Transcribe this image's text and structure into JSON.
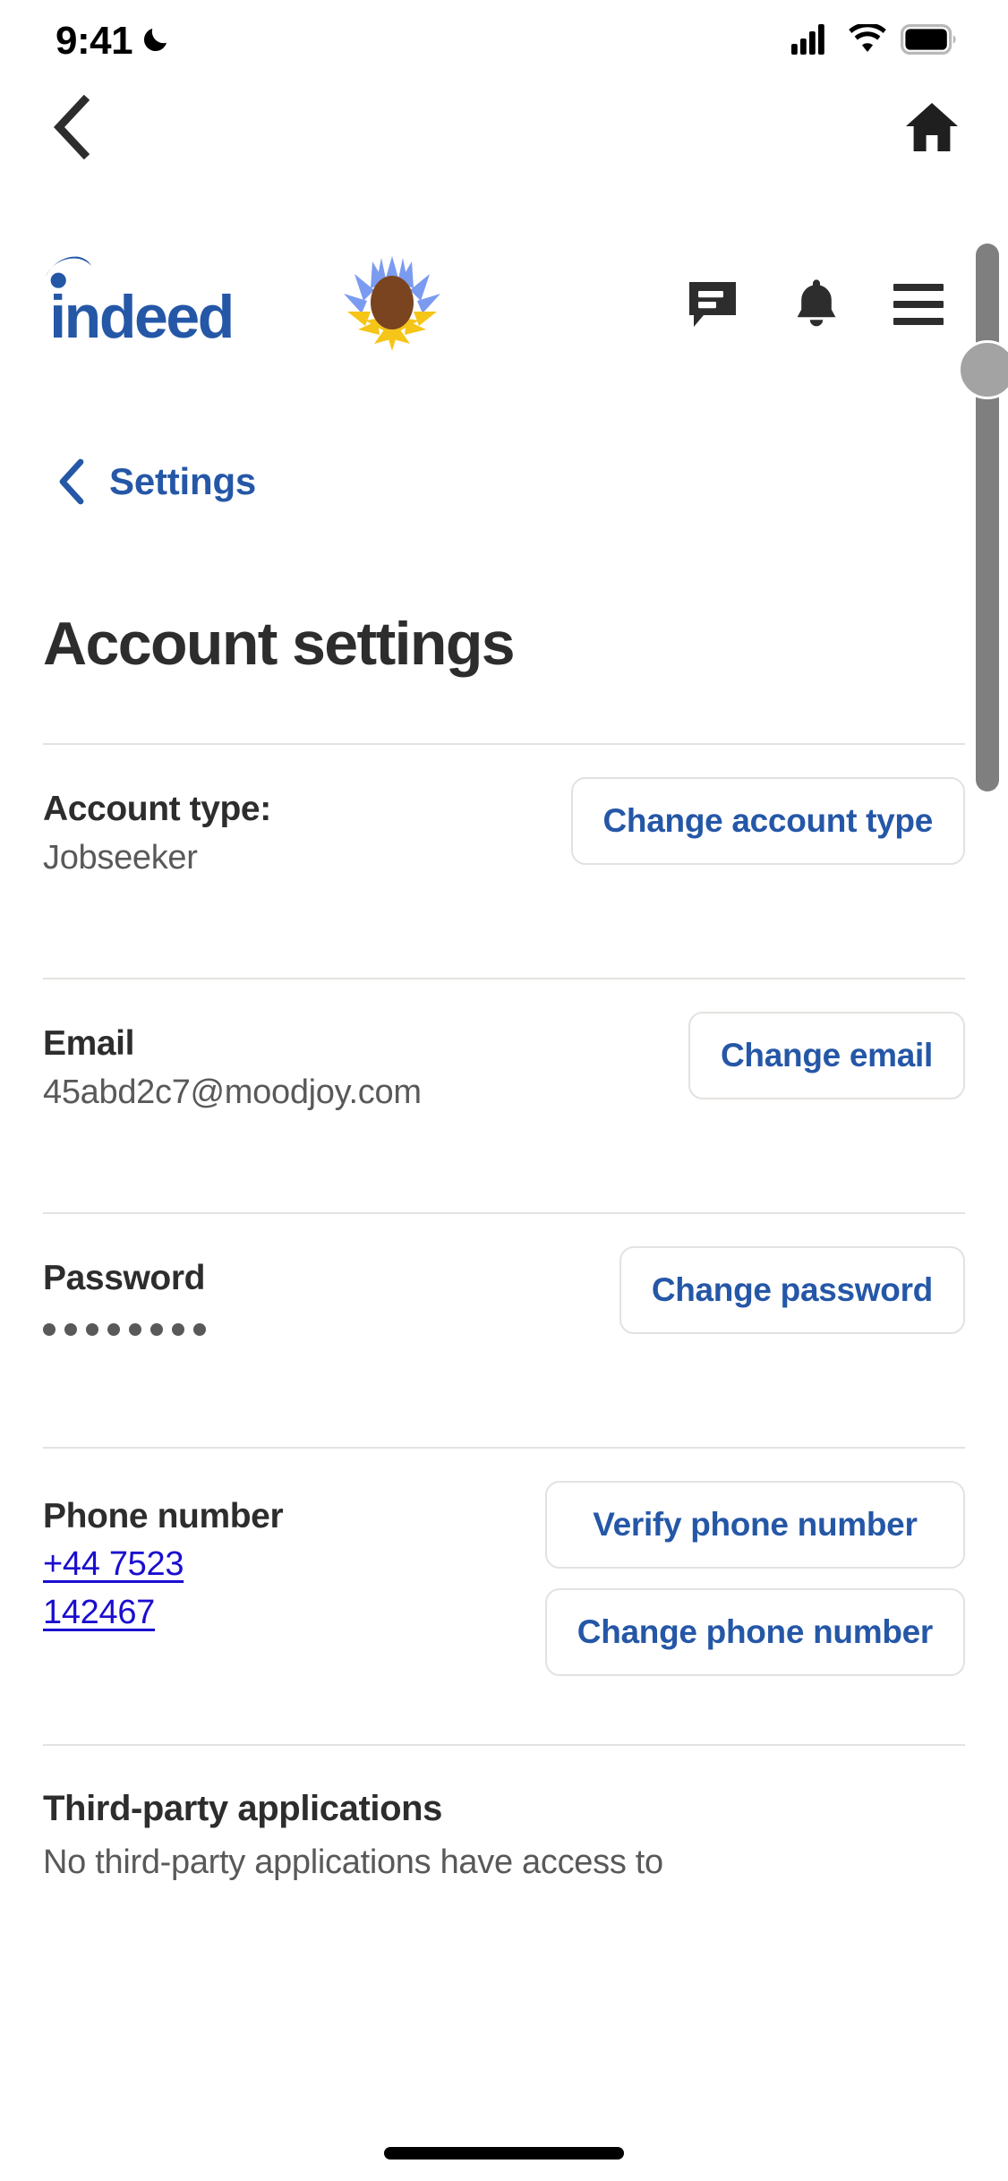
{
  "status_bar": {
    "time": "9:41",
    "dnd_icon": "moon-icon",
    "cellular_icon": "cellular-signal-icon",
    "wifi_icon": "wifi-icon",
    "battery_icon": "battery-full-icon"
  },
  "browser_nav": {
    "back_icon": "chevron-left-icon",
    "home_icon": "home-icon"
  },
  "site_header": {
    "logo_text": "indeed",
    "logo_color": "#2557a7",
    "sunflower_icon": "sunflower-icon",
    "messages_icon": "message-bubble-icon",
    "notifications_icon": "bell-icon",
    "menu_icon": "hamburger-menu-icon"
  },
  "breadcrumb": {
    "back_icon": "chevron-left-icon",
    "label": "Settings"
  },
  "page": {
    "title": "Account settings"
  },
  "sections": {
    "account_type": {
      "label": "Account type:",
      "value": "Jobseeker",
      "button": "Change account type"
    },
    "email": {
      "label": "Email",
      "value": "45abd2c7@moodjoy.com",
      "button": "Change email"
    },
    "password": {
      "label": "Password",
      "masked_value": "••••••••",
      "dot_count": 8,
      "button": "Change password"
    },
    "phone": {
      "label": "Phone number",
      "value_line1": "+44 7523",
      "value_line2": "142467",
      "verify_button": "Verify phone number",
      "change_button": "Change phone number"
    },
    "third_party": {
      "title": "Third-party applications",
      "description": "No third-party applications have access to"
    }
  },
  "colors": {
    "brand_blue": "#2557a7",
    "link_blue": "#1a0dcf",
    "text_dark": "#2d2d2d",
    "text_gray": "#595959",
    "border": "#e4e2e0"
  }
}
